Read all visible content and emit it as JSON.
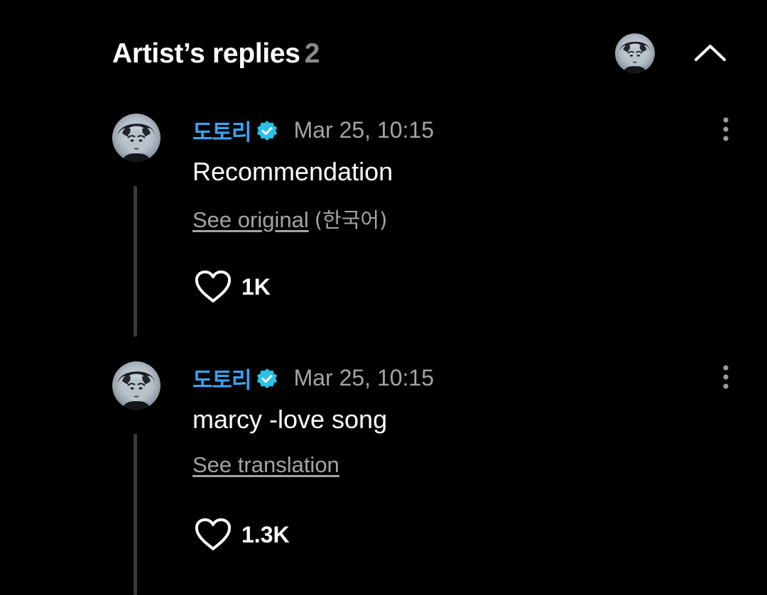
{
  "header": {
    "title": "Artist’s replies",
    "count": "2"
  },
  "replies": [
    {
      "author": "도토리",
      "timestamp": "Mar 25, 10:15",
      "text": "Recommendation",
      "translate_link": "See original",
      "translate_lang": "(한국어)",
      "likes": "1K"
    },
    {
      "author": "도토리",
      "timestamp": "Mar 25, 10:15",
      "text": "marcy -love song",
      "translate_link": "See translation",
      "translate_lang": "",
      "likes": "1.3K"
    }
  ],
  "icons": {
    "collapse": "chevron-up-icon",
    "verified": "verified-badge-icon",
    "like": "heart-outline-icon",
    "more": "more-vertical-icon"
  },
  "colors": {
    "background": "#000000",
    "author": "#39a3f5",
    "verified": "#29c2e6",
    "secondary_text": "#a4a4a4",
    "count": "#8a8a8a"
  }
}
